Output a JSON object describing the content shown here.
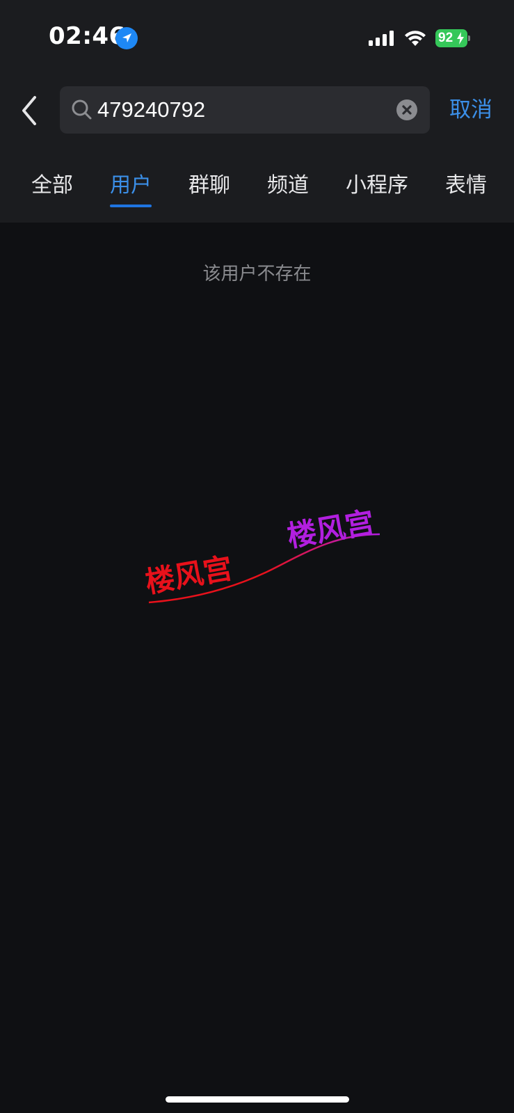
{
  "status_bar": {
    "time": "02:46",
    "battery_level": "92",
    "icons": [
      "location-arrow-icon",
      "signal-bars-icon",
      "wifi-icon",
      "battery-charging-icon"
    ]
  },
  "search": {
    "query": "479240792",
    "cancel_label": "取消",
    "icons": [
      "chevron-left-icon",
      "search-icon",
      "clear-icon"
    ]
  },
  "tabs": [
    {
      "label": "全部",
      "active": false
    },
    {
      "label": "用户",
      "active": true
    },
    {
      "label": "群聊",
      "active": false
    },
    {
      "label": "频道",
      "active": false
    },
    {
      "label": "小程序",
      "active": false
    },
    {
      "label": "表情",
      "active": false
    }
  ],
  "results": {
    "empty_message": "该用户不存在"
  },
  "watermark": {
    "text_left": "楼风宫",
    "text_right": "楼风宫",
    "color_left": "#e8111b",
    "color_right": "#b21fe0"
  },
  "colors": {
    "accent": "#3b8fe8",
    "header_bg": "#1b1c1f",
    "page_bg": "#0f1013",
    "battery": "#35c759"
  }
}
